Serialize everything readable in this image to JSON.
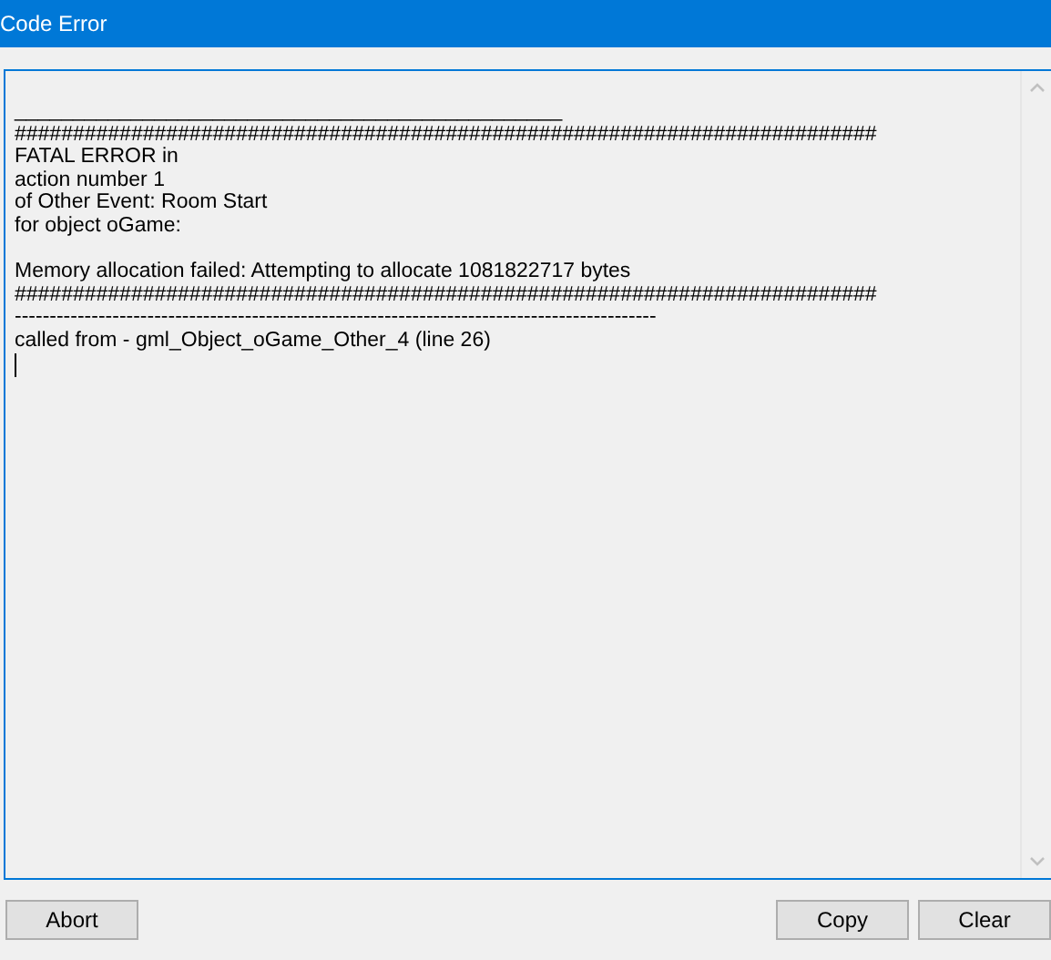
{
  "window": {
    "title": "Code Error"
  },
  "output": {
    "paragraphs": [
      [
        "_______________________________________________",
        "##########################################################################",
        "FATAL ERROR in",
        "action number 1",
        "of Other Event: Room Start",
        "for object oGame:"
      ],
      [
        "Memory allocation failed: Attempting to allocate 1081822717 bytes",
        "##########################################################################",
        "--------------------------------------------------------------------------------------------",
        "called from - gml_Object_oGame_Other_4 (line 26)"
      ]
    ]
  },
  "buttons": [
    {
      "label": "Abort",
      "kind": "left"
    },
    {
      "label": "Copy",
      "kind": "right"
    },
    {
      "label": "Clear",
      "kind": "right"
    }
  ]
}
